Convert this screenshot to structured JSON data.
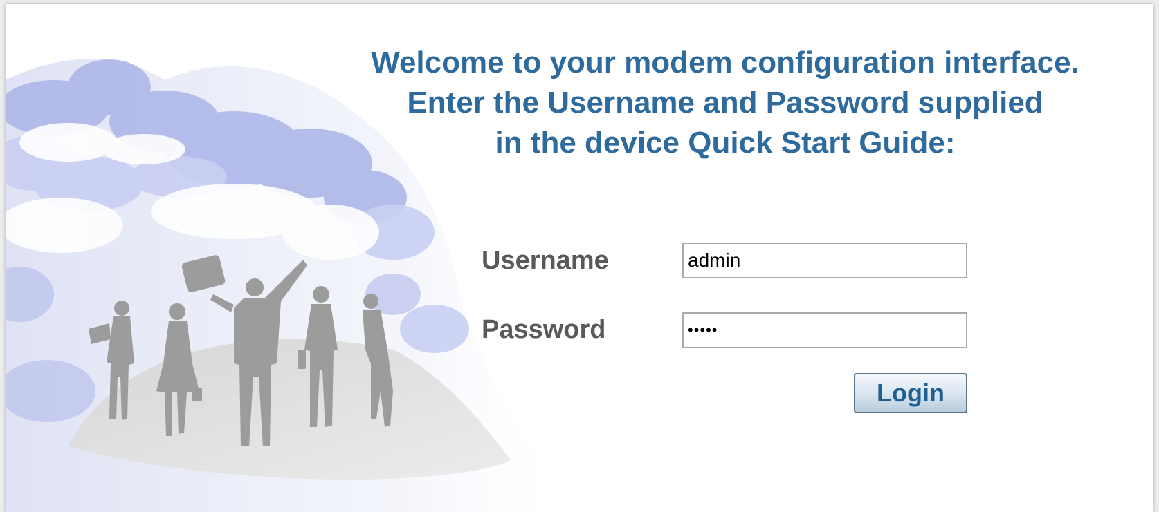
{
  "welcome": {
    "line1": "Welcome to your modem configuration interface.",
    "line2": "Enter the Username and Password supplied",
    "line3": "in the device Quick Start Guide:"
  },
  "login_form": {
    "username_label": "Username",
    "username_value": "admin",
    "password_label": "Password",
    "password_value": "•••••",
    "login_button_label": "Login"
  },
  "colors": {
    "heading": "#2e6a9c",
    "label": "#595959",
    "button_text": "#1f5e90",
    "cloud_blue": "#a8b4e6",
    "silhouette": "#9c9c9c"
  },
  "icons": {
    "artwork": "people-silhouettes-clouds-illustration"
  }
}
